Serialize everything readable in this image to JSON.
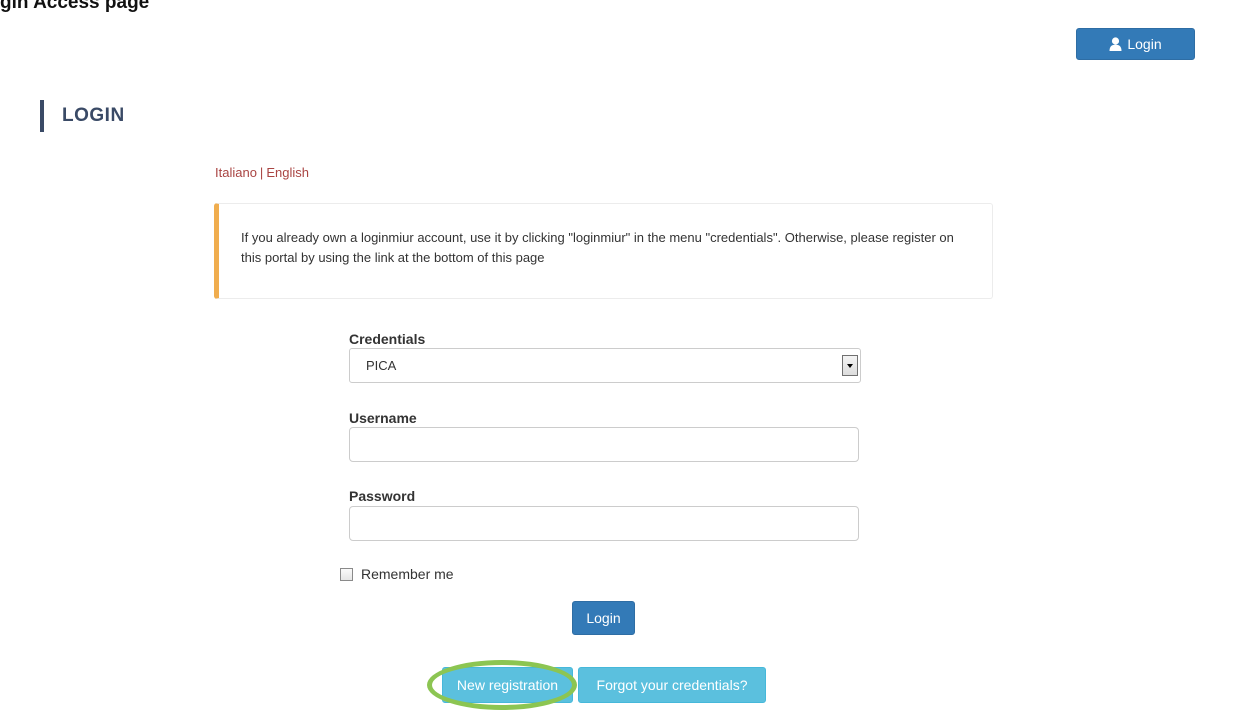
{
  "caption": "gin Access page",
  "header": {
    "login_button_label": "Login",
    "login_icon": "user-icon"
  },
  "page": {
    "title": "LOGIN"
  },
  "language": {
    "italiano": "Italiano",
    "separator": "|",
    "english": "English"
  },
  "notice": {
    "text": "If you already own a loginmiur account, use it by clicking \"loginmiur\" in the menu \"credentials\". Otherwise, please register on this portal by using the link at the bottom of this page",
    "accent_color": "#f0ad4e"
  },
  "form": {
    "credentials_label": "Credentials",
    "credentials_value": "PICA",
    "username_label": "Username",
    "username_value": "",
    "password_label": "Password",
    "password_value": "",
    "remember_label": "Remember me",
    "remember_checked": false,
    "login_label": "Login"
  },
  "actions": {
    "new_registration_label": "New registration",
    "forgot_label": "Forgot your credentials?"
  },
  "colors": {
    "primary": "#337ab7",
    "info": "#5bc0de",
    "link": "#a94442",
    "heading": "#3a4a66",
    "highlight": "#8cc552"
  }
}
